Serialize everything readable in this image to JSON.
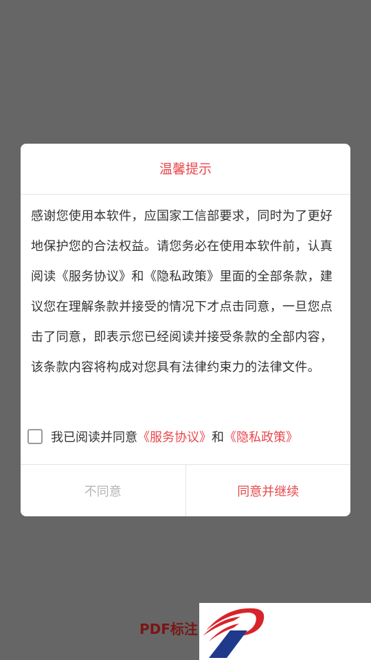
{
  "background": {
    "app_title": "PDF标注"
  },
  "dialog": {
    "title": "温馨提示",
    "body": "感谢您使用本软件，应国家工信部要求，同时为了更好地保护您的合法权益。请您务必在使用本软件前，认真阅读《服务协议》和《隐私政策》里面的全部条款，建议您在理解条款并接受的情况下才点击同意，一旦您点击了同意，即表示您已经阅读并接受条款的全部内容，该条款内容将构成对您具有法律约束力的法律文件。",
    "agree_prefix": "我已阅读并同意",
    "service_link": "《服务协议》",
    "and_text": "和",
    "privacy_link": "《隐私政策》",
    "checkbox_checked": false,
    "disagree_label": "不同意",
    "agree_label": "同意并继续"
  },
  "colors": {
    "accent": "#e8474b",
    "overlay": "#666666",
    "disabled_text": "#b5b5b5",
    "body_text": "#333333"
  },
  "icons": {
    "logo": "stylized-p-logo",
    "checkbox": "checkbox-unchecked"
  }
}
